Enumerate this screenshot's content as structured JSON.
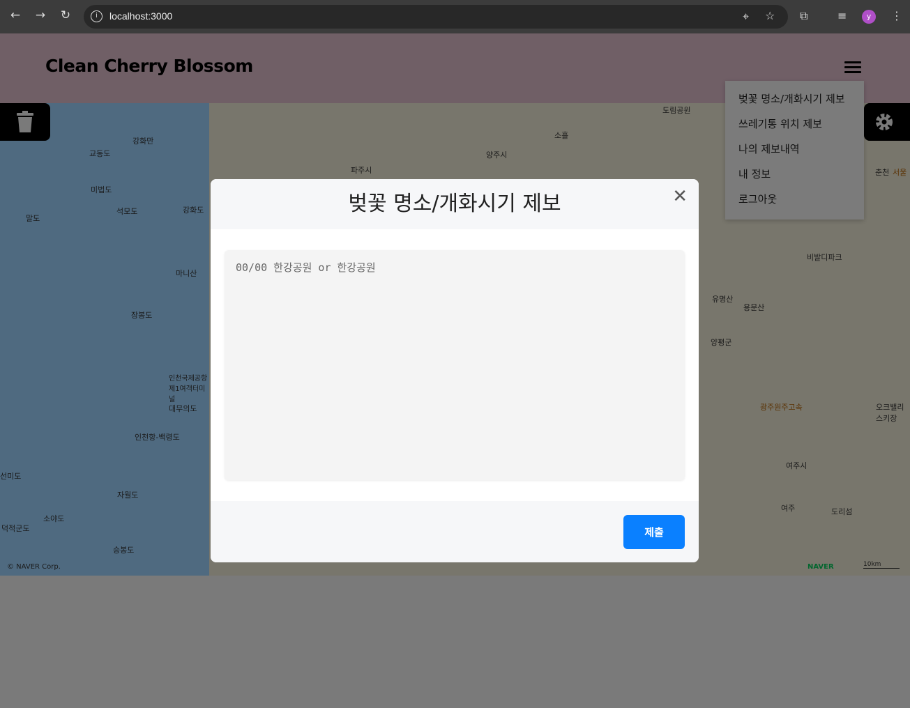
{
  "browser": {
    "url": "localhost:3000",
    "profile_initial": "y"
  },
  "header": {
    "brand": "Clean Cherry Blossom"
  },
  "menu": {
    "items": [
      "벚꽃 명소/개화시기 제보",
      "쓰레기통 위치 제보",
      "나의 제보내역",
      "내 정보",
      "로그아웃"
    ]
  },
  "map": {
    "labels": [
      "강화만",
      "교동도",
      "미법도",
      "석모도",
      "강화도",
      "말도",
      "마니산",
      "장봉도",
      "인천국제공항 제1여객터미널",
      "대무의도",
      "인천항-백령도",
      "선미도",
      "자월도",
      "소야도",
      "덕적군도",
      "승봉도",
      "파주시",
      "양주시",
      "소흘",
      "도림공원",
      "비발디파크",
      "유명산",
      "용문산",
      "양평군",
      "광주원주고속",
      "오크밸리 스키장",
      "여주시",
      "여주",
      "도리섬",
      "춘천",
      "서울"
    ],
    "attribution": "© NAVER Corp.",
    "logo": "NAVER",
    "scale": "10km"
  },
  "modal": {
    "title": "벚꽃 명소/개화시기 제보",
    "placeholder": "00/00 한강공원 or 한강공원",
    "submit": "제출"
  }
}
